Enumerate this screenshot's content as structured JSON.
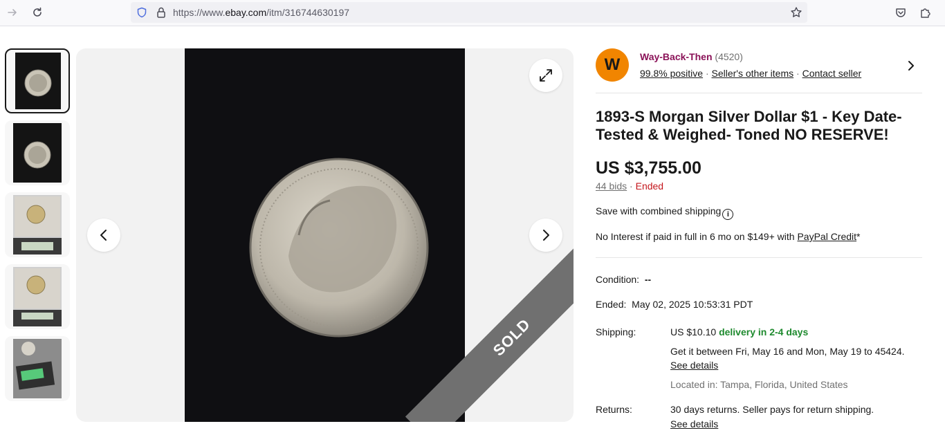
{
  "browser": {
    "url_prefix": "https://www.",
    "url_host": "ebay.com",
    "url_path": "/itm/316744630197"
  },
  "seller": {
    "avatar_letter": "W",
    "name": "Way-Back-Then",
    "feedback_count": "(4520)",
    "positive": "99.8% positive",
    "other_items": "Seller's other items",
    "contact": "Contact seller"
  },
  "listing": {
    "title": "1893-S Morgan Silver Dollar $1 - Key Date- Tested & Weighed- Toned NO RESERVE!",
    "price": "US $3,755.00",
    "bids": "44 bids",
    "status": "Ended",
    "combined_shipping": "Save with combined shipping",
    "financing_prefix": "No Interest if paid in full in 6 mo on $149+ with ",
    "financing_link": "PayPal Credit",
    "financing_suffix": "*"
  },
  "gallery": {
    "sold_label": "SOLD",
    "thumbnail_count": 5,
    "selected_index": 0
  },
  "details": {
    "condition_label": "Condition:",
    "condition_value": "--",
    "ended_label": "Ended:",
    "ended_value": "May 02, 2025 10:53:31 PDT",
    "shipping_label": "Shipping:",
    "shipping_cost": "US $10.10",
    "shipping_speed": "delivery in 2-4 days",
    "shipping_dates": "Get it between Fri, May 16 and Mon, May 19 to 45424.",
    "shipping_see_details": "See details",
    "located_in": "Located in: Tampa, Florida, United States",
    "returns_label": "Returns:",
    "returns_value": "30 days returns. Seller pays for return shipping.",
    "returns_see_details": "See details"
  },
  "colors": {
    "seller_name": "#8a1157",
    "avatar": "#f18500",
    "ended": "#c4161c",
    "delivery": "#1e8a2e"
  }
}
